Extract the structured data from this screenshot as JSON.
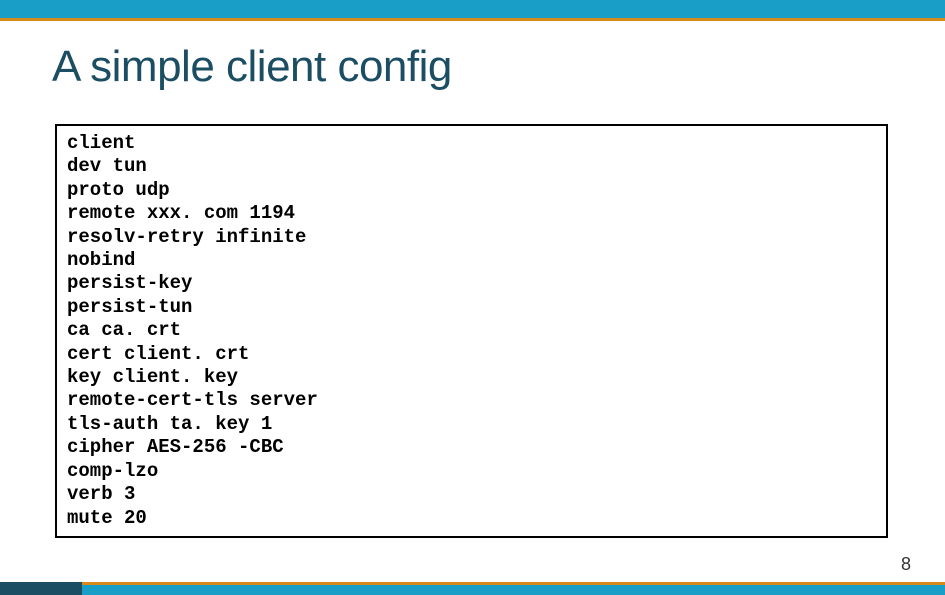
{
  "title": "A simple client config",
  "code_lines": [
    "client",
    "dev tun",
    "proto udp",
    "remote xxx. com 1194",
    "resolv-retry infinite",
    "nobind",
    "persist-key",
    "persist-tun",
    "ca ca. crt",
    "cert client. crt",
    "key client. key",
    "remote-cert-tls server",
    "tls-auth ta. key 1",
    "cipher AES-256 -CBC",
    "comp-lzo",
    "verb 3",
    "mute 20"
  ],
  "page_number": "8"
}
